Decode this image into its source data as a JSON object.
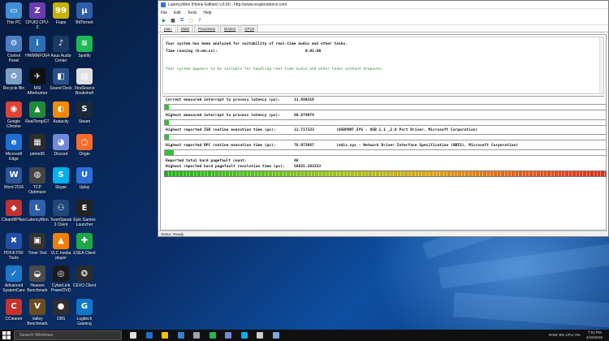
{
  "desktop": {
    "icons": [
      {
        "label": "This PC",
        "icon": "this-pc-icon",
        "color": "#3f8fd6",
        "glyph": "▭"
      },
      {
        "label": "CPUID CPU-Z",
        "icon": "cpuz-icon",
        "color": "#6b3bb0",
        "glyph": "Z"
      },
      {
        "label": "Fraps",
        "icon": "fraps-icon",
        "color": "#c8b200",
        "glyph": "99"
      },
      {
        "label": "BitTorrent",
        "icon": "bittorrent-icon",
        "color": "#2e5ea8",
        "glyph": "µ"
      },
      {
        "label": "Control Panel",
        "icon": "control-panel-icon",
        "color": "#4a7fc0",
        "glyph": "⚙"
      },
      {
        "label": "HWMiNFO64",
        "icon": "hwinfo-icon",
        "color": "#2b6fb3",
        "glyph": "i"
      },
      {
        "label": "Asus Audio Center",
        "icon": "asus-audio-icon",
        "color": "#1a3a66",
        "glyph": "♪"
      },
      {
        "label": "Spotify",
        "icon": "spotify-icon",
        "color": "#1db954",
        "glyph": "≋"
      },
      {
        "label": "Recycle Bin",
        "icon": "recycle-bin-icon",
        "color": "#7aa0c8",
        "glyph": "♻"
      },
      {
        "label": "MSI Afterburner",
        "icon": "msi-afterburner-icon",
        "color": "#111111",
        "glyph": "✈"
      },
      {
        "label": "Sound Deck",
        "icon": "sound-deck-icon",
        "color": "#2a4f8a",
        "glyph": "◧"
      },
      {
        "label": "XtraSource Bookshelf",
        "icon": "bookshelf-icon",
        "color": "#e0e0e0",
        "glyph": "▤"
      },
      {
        "label": "Google Chrome",
        "icon": "chrome-icon",
        "color": "#db4437",
        "glyph": "◉"
      },
      {
        "label": "RealTempGT",
        "icon": "realtemp-icon",
        "color": "#1e8a3a",
        "glyph": "▲"
      },
      {
        "label": "Audacity",
        "icon": "audacity-icon",
        "color": "#f28a00",
        "glyph": "◐"
      },
      {
        "label": "Steam",
        "icon": "steam-icon",
        "color": "#1b2838",
        "glyph": "S"
      },
      {
        "label": "Microsoft Edge",
        "icon": "edge-icon",
        "color": "#1f6fd1",
        "glyph": "e"
      },
      {
        "label": "prime95",
        "icon": "prime95-icon",
        "color": "#2b2b2b",
        "glyph": "▦"
      },
      {
        "label": "Discord",
        "icon": "discord-icon",
        "color": "#7289da",
        "glyph": "◕"
      },
      {
        "label": "Origin",
        "icon": "origin-icon",
        "color": "#f56c2d",
        "glyph": "○"
      },
      {
        "label": "Word 2016",
        "icon": "word-icon",
        "color": "#2b579a",
        "glyph": "W"
      },
      {
        "label": "TCP Optimizer",
        "icon": "tcp-optimizer-icon",
        "color": "#444444",
        "glyph": "◍"
      },
      {
        "label": "Skype",
        "icon": "skype-icon",
        "color": "#00aff0",
        "glyph": "S"
      },
      {
        "label": "Uplay",
        "icon": "uplay-icon",
        "color": "#2a6fd6",
        "glyph": "U"
      },
      {
        "label": "CleanMPNavigatorEX",
        "icon": "cleanmp-icon",
        "color": "#c23232",
        "glyph": "◆"
      },
      {
        "label": "LatencyMon",
        "icon": "latencymon-icon",
        "color": "#2e5fa8",
        "glyph": "L"
      },
      {
        "label": "TeamSpeak 3 Client",
        "icon": "teamspeak-icon",
        "color": "#23477a",
        "glyph": "⚇"
      },
      {
        "label": "Epic Games Launcher",
        "icon": "epic-games-icon",
        "color": "#222222",
        "glyph": "E"
      },
      {
        "label": "PDFill PDF Tools",
        "icon": "pdfill-icon",
        "color": "#2250a8",
        "glyph": "✖"
      },
      {
        "label": "Timer Tool",
        "icon": "timer-tool-icon",
        "color": "#333333",
        "glyph": "▣"
      },
      {
        "label": "VLC media player",
        "icon": "vlc-icon",
        "color": "#f08000",
        "glyph": "▲"
      },
      {
        "label": "ESEA Client",
        "icon": "esea-icon",
        "color": "#1fa84a",
        "glyph": "✚"
      },
      {
        "label": "Advanced SystemCare 9",
        "icon": "systemcare-icon",
        "color": "#1e78c8",
        "glyph": "✓"
      },
      {
        "label": "Heaven Benchmark",
        "icon": "heaven-icon",
        "color": "#4b4b4b",
        "glyph": "◒"
      },
      {
        "label": "CyberLink PowerDVD 15",
        "icon": "powerdvd-icon",
        "color": "#1b1b1b",
        "glyph": "◎"
      },
      {
        "label": "CEVO Client",
        "icon": "cevo-icon",
        "color": "#2c2c2c",
        "glyph": "❂"
      },
      {
        "label": "CCleaner",
        "icon": "ccleaner-icon",
        "color": "#c8322d",
        "glyph": "C"
      },
      {
        "label": "Valley Benchmark",
        "icon": "valley-icon",
        "color": "#6a4e23",
        "glyph": "V"
      },
      {
        "label": "OBS",
        "icon": "obs-icon",
        "color": "#302e31",
        "glyph": "●"
      },
      {
        "label": "Logitech Gaming",
        "icon": "logitech-icon",
        "color": "#0f77c8",
        "glyph": "G"
      }
    ]
  },
  "window": {
    "title": "LatencyMon (Home Edition)  v.6.50 - http://www.resplendence.com",
    "menu": [
      "File",
      "Edit",
      "Tools",
      "Help"
    ],
    "toolbar": [
      {
        "icon": "start-monitor-icon",
        "glyph": "▶",
        "color": "#1fa01f"
      },
      {
        "icon": "stop-monitor-icon",
        "glyph": "■",
        "color": "#555555"
      },
      {
        "icon": "copy-icon",
        "glyph": "⧉",
        "color": "#3a6fc8"
      },
      {
        "icon": "save-icon",
        "glyph": "▢",
        "color": "#c89a00"
      },
      {
        "icon": "help-icon",
        "glyph": "?",
        "color": "#1f4fb0"
      }
    ],
    "tabs": [
      "Main",
      "Stats",
      "Processes",
      "Drivers",
      "CPUs"
    ],
    "summary": {
      "analyzed_text": "Your system has been analyzed for suitability of real-time audio and other tasks.",
      "time_running_label": "Time running (h:mm:ss):",
      "time_running_value": "0:01:00",
      "verdict": "Your system appears to be suitable for handling real-time audio and other tasks without dropouts.",
      "verdict_color": "#2a8a2a"
    },
    "metrics": {
      "interrupt_latency_label": "Current measured interrupt to process latency (µs):",
      "interrupt_latency_value": "11.669316",
      "interrupt_latency_level": 0.01,
      "highest_interrupt_label": "Highest measured interrupt to process latency (µs):",
      "highest_interrupt_value": "68.874974",
      "highest_interrupt_level": 0.01,
      "isr_label": "Highest reported ISR routine execution time (µs):",
      "isr_value": "11.717333",
      "isr_driver": "(USBPORT.SYS - USB 1.1 _2.0 Port Driver, Microsoft Corporation)",
      "isr_level": 0.0,
      "dpc_label": "Highest reported DPC routine execution time (µs):",
      "dpc_value": "76.973667",
      "dpc_driver": "(ndis.sys - Network Driver Interface Specification (NDIS), Microsoft Corporation)",
      "dpc_level": 0.02,
      "pagefault_count_label": "Reported total hard pagefault count:",
      "pagefault_count_value": "48",
      "pagefault_time_label": "Highest reported hard pagefault resolution time (µs):",
      "pagefault_time_value": "56825.283333",
      "pagefault_level": 1.0
    },
    "status": "Status: Ready"
  },
  "taskbar": {
    "search_placeholder": "Search Windows",
    "apps": [
      {
        "icon": "task-view-icon",
        "color": "#e0e0e0"
      },
      {
        "icon": "edge-taskbar-icon",
        "color": "#1f6fd1"
      },
      {
        "icon": "explorer-taskbar-icon",
        "color": "#f2c200"
      },
      {
        "icon": "store-taskbar-icon",
        "color": "#3a7fd0"
      },
      {
        "icon": "steam-taskbar-icon",
        "color": "#9aa4b0"
      },
      {
        "icon": "spotify-taskbar-icon",
        "color": "#1db954"
      },
      {
        "icon": "discord-taskbar-icon",
        "color": "#7289da"
      },
      {
        "icon": "skype-taskbar-icon",
        "color": "#00aff0"
      },
      {
        "icon": "settings-taskbar-icon",
        "color": "#cccccc"
      },
      {
        "icon": "latencymon-taskbar-icon",
        "color": "#7fa8e0"
      }
    ],
    "tray_text": "RAM: 9%   CPU: 0%",
    "clock_time": "7:51 PM",
    "clock_date": "4/16/2016"
  }
}
